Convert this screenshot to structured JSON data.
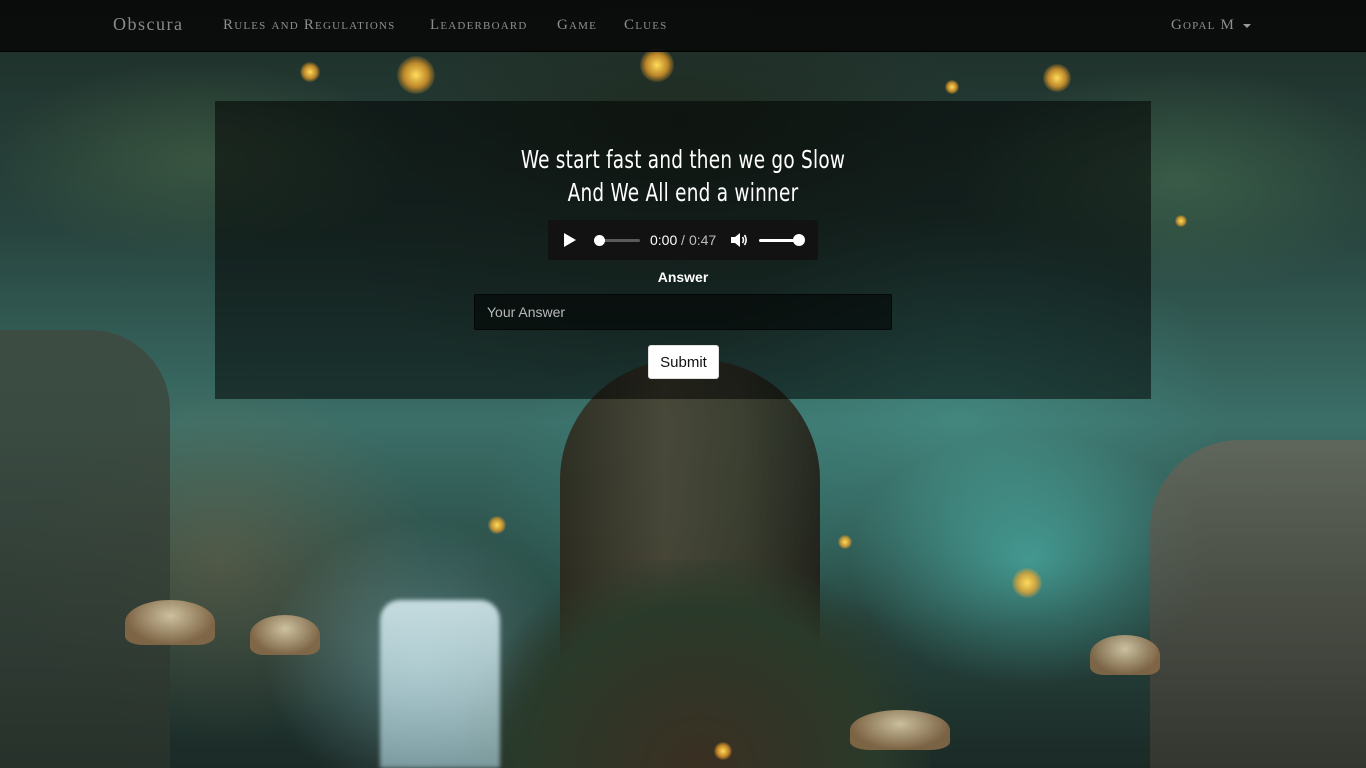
{
  "navbar": {
    "brand": "Obscura",
    "items": [
      {
        "label": "Rules and Regulations"
      },
      {
        "label": "Leaderboard"
      },
      {
        "label": "Game"
      },
      {
        "label": "Clues"
      }
    ],
    "user": {
      "name": "Gopal M",
      "icon": "caret-down-icon"
    }
  },
  "clue": {
    "line1": "We start fast and then we go Slow",
    "line2": "And We All end a winner"
  },
  "audio": {
    "current_time": "0:00",
    "separator": "/",
    "duration": "0:47",
    "progress": 0,
    "volume": 1,
    "icons": {
      "play": "play-icon",
      "volume": "volume-icon"
    }
  },
  "form": {
    "label": "Answer",
    "placeholder": "Your Answer",
    "value": "",
    "submit_label": "Submit"
  },
  "colors": {
    "navbar_bg": "#080808",
    "nav_text": "#8e8e8e",
    "panel_bg": "#000000",
    "text": "#ffffff"
  }
}
